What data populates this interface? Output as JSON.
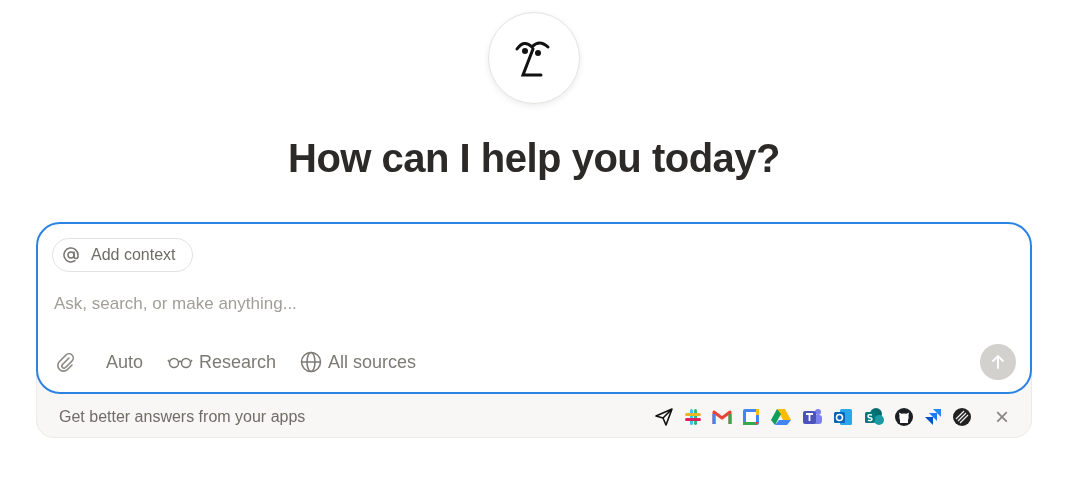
{
  "heading": "How can I help you today?",
  "composer": {
    "context_chip": "Add context",
    "input": {
      "placeholder": "Ask, search, or make anything..."
    },
    "tools": [
      {
        "kind": "attach"
      },
      {
        "kind": "mode",
        "label": "Auto"
      },
      {
        "kind": "research",
        "label": "Research"
      },
      {
        "kind": "sources",
        "label": "All sources"
      }
    ],
    "send": {
      "disabled": true
    }
  },
  "apps_banner": {
    "text": "Get better answers from your apps",
    "close": "×"
  }
}
